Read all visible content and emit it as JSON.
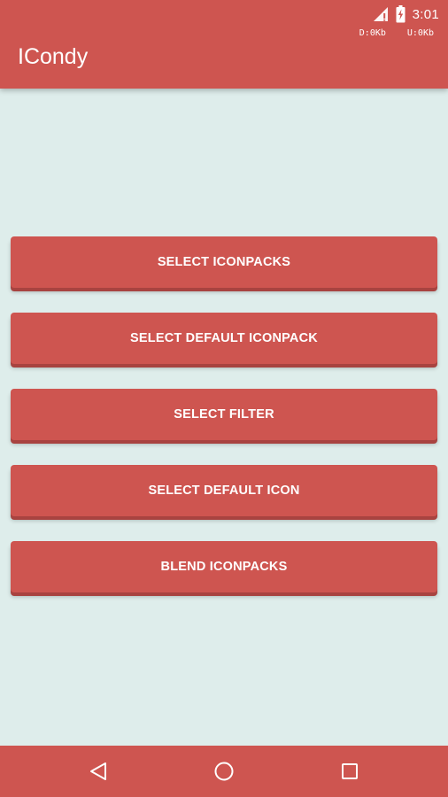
{
  "status_bar": {
    "time": "3:01",
    "download": "D:0Kb",
    "upload": "U:0Kb",
    "icons": [
      "signal-icon",
      "battery-charging-icon"
    ]
  },
  "app_bar": {
    "title": "ICondy"
  },
  "buttons": [
    {
      "label": "SELECT ICONPACKS"
    },
    {
      "label": "SELECT DEFAULT ICONPACK"
    },
    {
      "label": "SELECT FILTER"
    },
    {
      "label": "SELECT DEFAULT ICON"
    },
    {
      "label": "BLEND ICONPACKS"
    }
  ],
  "navigation_bar": {
    "icons": [
      "back-icon",
      "home-icon",
      "recents-icon"
    ]
  },
  "colors": {
    "accent": "#ce5550",
    "background": "#deedeb",
    "text_on_accent": "#ffffff"
  }
}
